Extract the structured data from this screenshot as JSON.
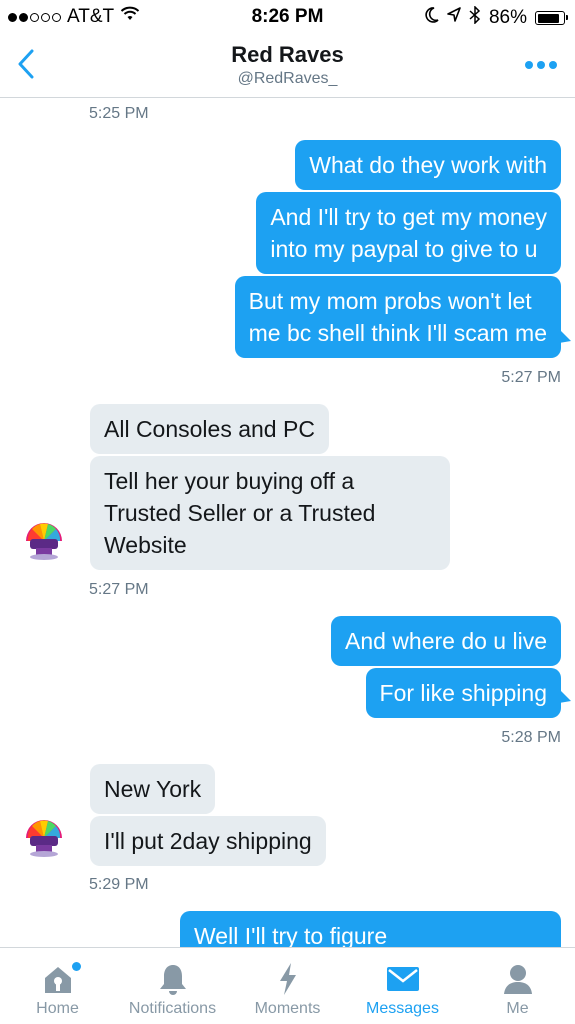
{
  "status_bar": {
    "carrier": "AT&T",
    "time": "8:26 PM",
    "battery": "86%",
    "battery_level": 0.86,
    "signal_bars_filled": 2,
    "signal_bars_total": 5
  },
  "header": {
    "title": "Red Raves",
    "handle": "@RedRaves_",
    "back_icon": "chevron-left-icon",
    "more_icon": "more-dots-icon"
  },
  "messages": {
    "ts1": "5:25 PM",
    "m1": "What do they work with",
    "m2_l1": "And I'll try to get my money",
    "m2_l2": "into my paypal to give to u",
    "m3_l1": "But my mom probs won't let",
    "m3_l2": "me bc shell think I'll scam me",
    "ts2": "5:27 PM",
    "r1": "All Consoles and PC",
    "r2_l1": "Tell her your buying off a",
    "r2_l2": "Trusted Seller or a Trusted",
    "r2_l3": "Website",
    "ts3": "5:27 PM",
    "m4": "And where do u live",
    "m5": "For like shipping",
    "ts4": "5:28 PM",
    "r3": "New York",
    "r4": "I'll put 2day shipping",
    "ts5": "5:29 PM",
    "m6_partial": "Well I'll try to figure"
  },
  "tabbar": {
    "tabs": [
      {
        "label": "Home",
        "icon": "home-icon"
      },
      {
        "label": "Notifications",
        "icon": "bell-icon"
      },
      {
        "label": "Moments",
        "icon": "lightning-icon"
      },
      {
        "label": "Messages",
        "icon": "envelope-icon"
      },
      {
        "label": "Me",
        "icon": "person-icon"
      }
    ],
    "active": "Messages"
  },
  "colors": {
    "accent": "#1da1f2",
    "received_bubble": "#e6ecf0",
    "secondary_text": "#657786",
    "inactive_tab": "#8899a6"
  }
}
